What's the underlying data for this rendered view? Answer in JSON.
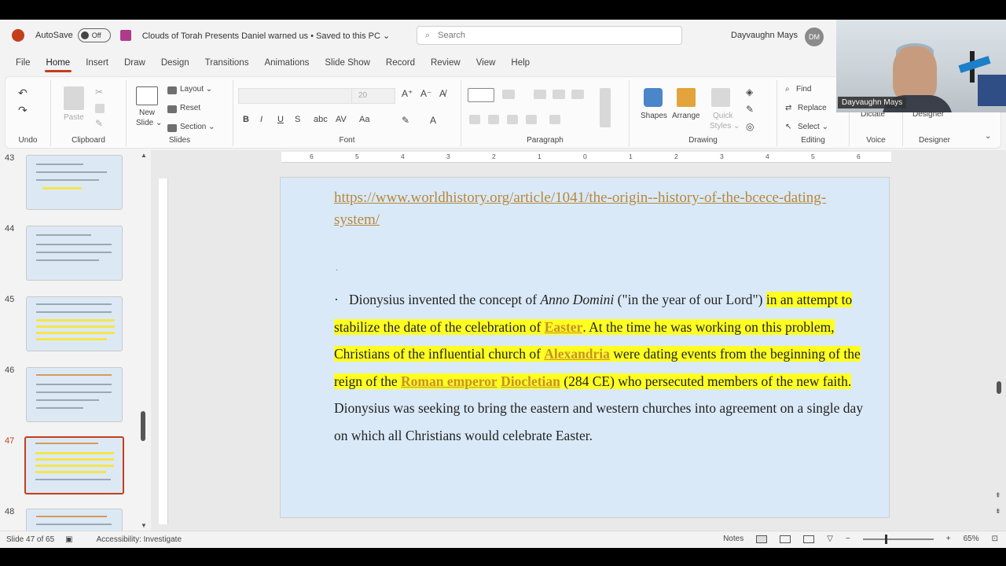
{
  "titlebar": {
    "autosave_label": "AutoSave",
    "autosave_state": "Off",
    "document_title": "Clouds of Torah Presents Daniel warned us • Saved to this PC ⌄",
    "search_placeholder": "Search",
    "user_name": "Dayvaughn Mays",
    "user_initials": "DM"
  },
  "tabs": [
    "File",
    "Home",
    "Insert",
    "Draw",
    "Design",
    "Transitions",
    "Animations",
    "Slide Show",
    "Record",
    "Review",
    "View",
    "Help"
  ],
  "ribbon": {
    "undo_label": "Undo",
    "clipboard": {
      "paste": "Paste",
      "label": "Clipboard"
    },
    "slides": {
      "new_slide": "New",
      "new_slide2": "Slide ⌄",
      "layout": "Layout ⌄",
      "reset": "Reset",
      "section": "Section ⌄",
      "label": "Slides"
    },
    "font": {
      "label": "Font",
      "size": "20",
      "bold": "B",
      "italic": "I",
      "underline": "U",
      "strike": "S"
    },
    "paragraph": {
      "label": "Paragraph"
    },
    "drawing": {
      "shapes": "Shapes",
      "arrange": "Arrange",
      "quick_styles": "Quick",
      "quick_styles2": "Styles ⌄",
      "label": "Drawing"
    },
    "editing": {
      "find": "Find",
      "replace": "Replace",
      "select": "Select ⌄",
      "label": "Editing"
    },
    "voice": {
      "dictate": "Dictate",
      "label": "Voice"
    },
    "designer": {
      "button": "Designer",
      "label": "Designer"
    }
  },
  "webcam": {
    "name_tag": "Dayvaughn Mays"
  },
  "thumbnails": [
    {
      "num": "43",
      "active": false
    },
    {
      "num": "44",
      "active": false
    },
    {
      "num": "45",
      "active": false
    },
    {
      "num": "46",
      "active": false
    },
    {
      "num": "47",
      "active": true
    },
    {
      "num": "48",
      "active": false
    }
  ],
  "ruler_ticks": [
    "6",
    "5",
    "4",
    "3",
    "2",
    "1",
    "0",
    "1",
    "2",
    "3",
    "4",
    "5",
    "6"
  ],
  "slide": {
    "link_url": "https://www.worldhistory.org/article/1041/the-origin--history-of-the-bcece-dating-system/",
    "bullet_dot": "·",
    "p_bullet": "·",
    "p1": "Dionysius invented the concept of ",
    "p1_italic": "Anno Domini",
    "p1_after": " (\"in the year of our Lord\") ",
    "hl1": "in an attempt to stabilize the date of the celebration of ",
    "link_easter": "Easter",
    "hl2": ". At the time he was working on this problem, Christians of the influential church of ",
    "link_alexandria": "Alexandria",
    "hl3": " were dating events from the beginning of the reign of the ",
    "link_roman": "Roman emperor",
    "hl4": " ",
    "link_diocletian": "Diocletian",
    "hl5": " (284 CE) who persecuted members of the new faith.",
    "p2": " Dionysius was seeking to bring the eastern and western churches into agreement on a single day on which all Christians would celebrate Easter."
  },
  "status": {
    "slide_count": "Slide 47 of 65",
    "accessibility": "Accessibility: Investigate",
    "notes": "Notes",
    "zoom_minus": "−",
    "zoom_plus": "+",
    "zoom_level": "65%"
  }
}
